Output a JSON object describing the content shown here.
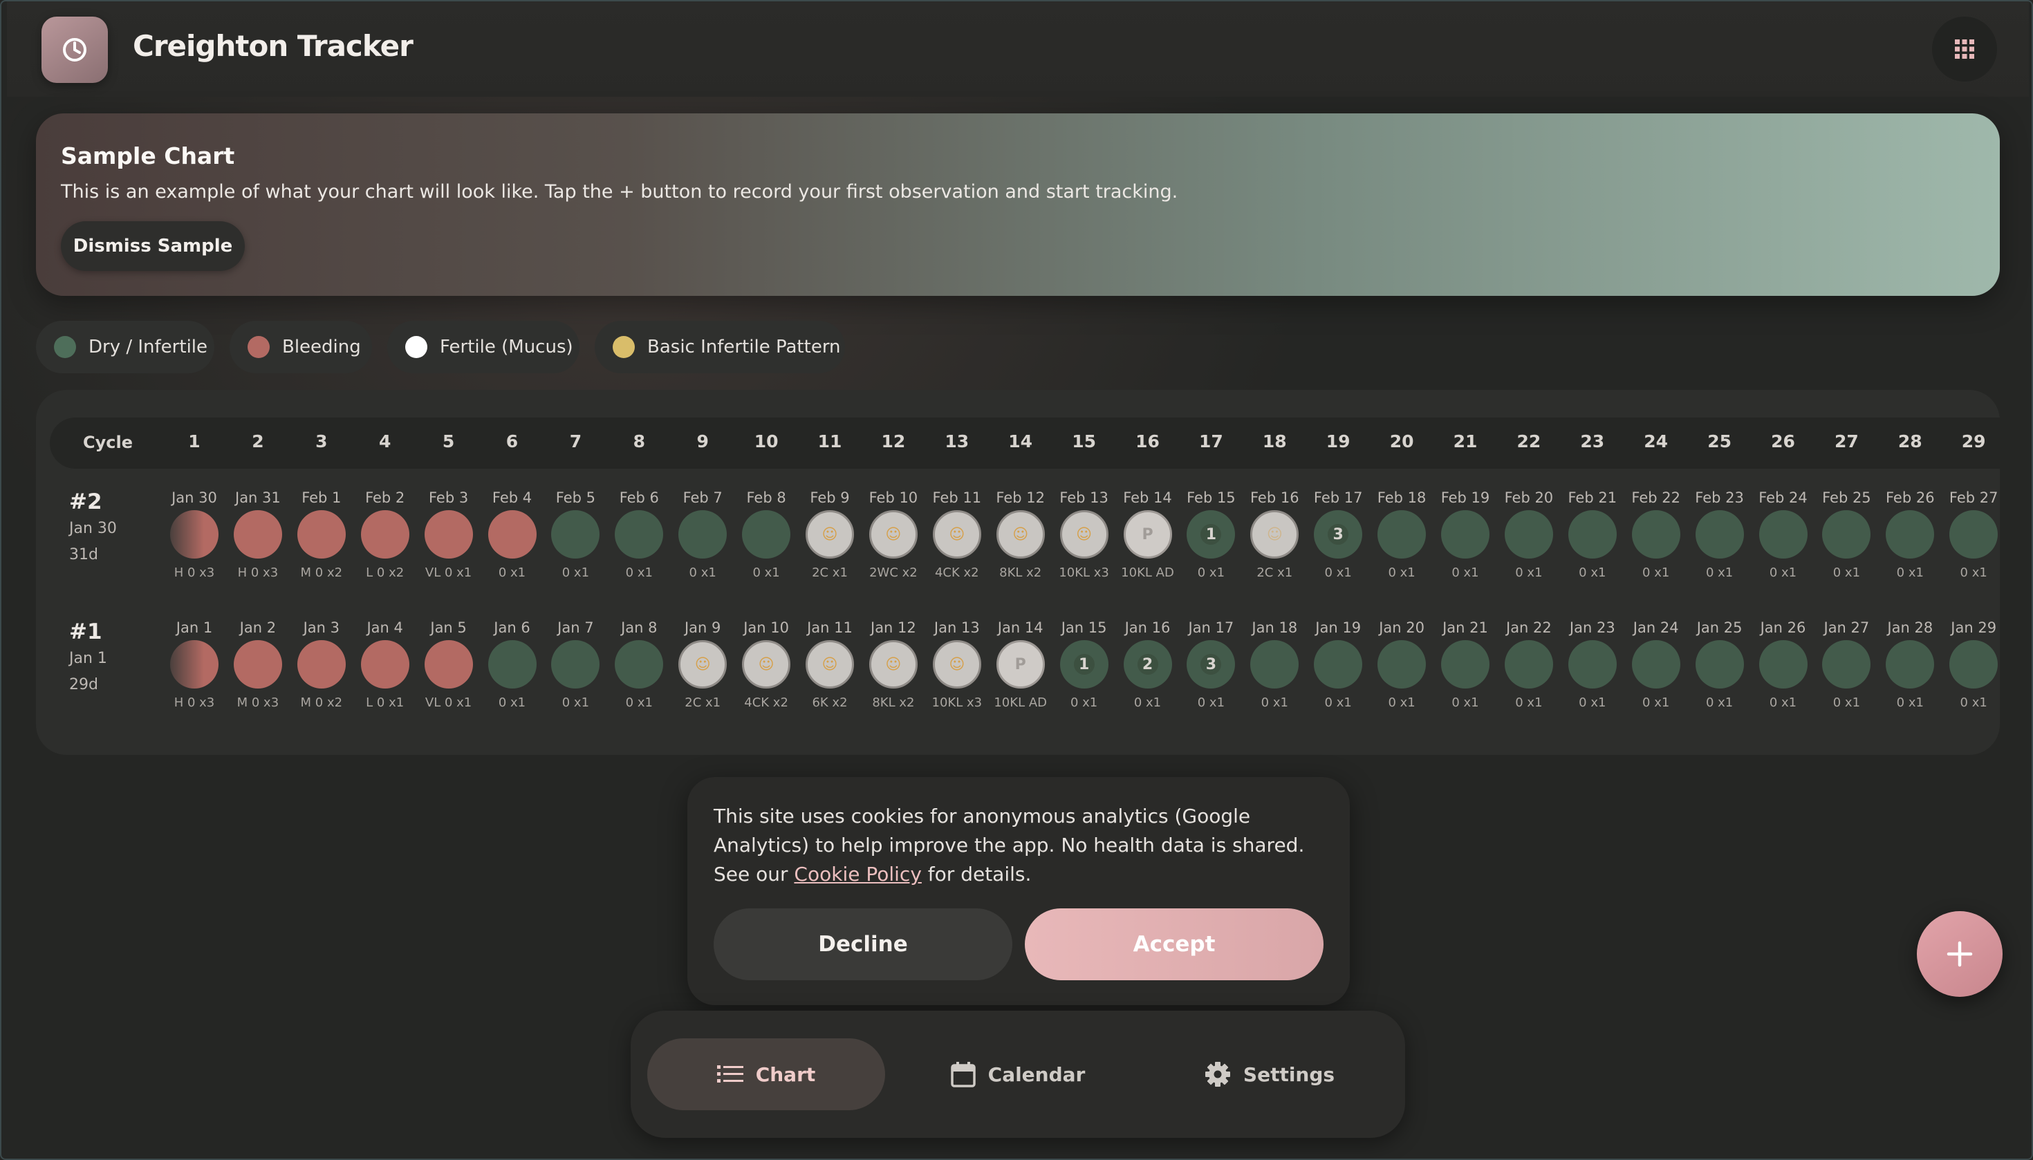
{
  "app": {
    "title": "Creighton Tracker"
  },
  "banner": {
    "title": "Sample Chart",
    "text": "This is an example of what your chart will look like. Tap the + button to record your first observation and start tracking.",
    "dismiss_label": "Dismiss Sample"
  },
  "legend": [
    {
      "label": "Dry / Infertile",
      "color": "#4e6e5a"
    },
    {
      "label": "Bleeding",
      "color": "#b36a63"
    },
    {
      "label": "Fertile (Mucus)",
      "color": "#ffffff"
    },
    {
      "label": "Basic Infertile Pattern",
      "color": "#d9bd6a"
    }
  ],
  "chart": {
    "cycle_header": "Cycle",
    "columns": [
      "1",
      "2",
      "3",
      "4",
      "5",
      "6",
      "7",
      "8",
      "9",
      "10",
      "11",
      "12",
      "13",
      "14",
      "15",
      "16",
      "17",
      "18",
      "19",
      "20",
      "21",
      "22",
      "23",
      "24",
      "25",
      "26",
      "27",
      "28",
      "29"
    ],
    "cycles": [
      {
        "number": "#2",
        "start": "Jan 30",
        "length": "31d",
        "days": [
          {
            "date": "Jan 30",
            "obs": "H 0 x3",
            "type": "bleed-fade"
          },
          {
            "date": "Jan 31",
            "obs": "H 0 x3",
            "type": "bleed"
          },
          {
            "date": "Feb 1",
            "obs": "M 0 x2",
            "type": "bleed"
          },
          {
            "date": "Feb 2",
            "obs": "L 0 x2",
            "type": "bleed"
          },
          {
            "date": "Feb 3",
            "obs": "VL 0 x1",
            "type": "bleed"
          },
          {
            "date": "Feb 4",
            "obs": "0 x1",
            "type": "bleed"
          },
          {
            "date": "Feb 5",
            "obs": "0 x1",
            "type": "dry"
          },
          {
            "date": "Feb 6",
            "obs": "0 x1",
            "type": "dry"
          },
          {
            "date": "Feb 7",
            "obs": "0 x1",
            "type": "dry"
          },
          {
            "date": "Feb 8",
            "obs": "0 x1",
            "type": "dry"
          },
          {
            "date": "Feb 9",
            "obs": "2C x1",
            "type": "fertile"
          },
          {
            "date": "Feb 10",
            "obs": "2WC x2",
            "type": "fertile"
          },
          {
            "date": "Feb 11",
            "obs": "4CK x2",
            "type": "fertile"
          },
          {
            "date": "Feb 12",
            "obs": "8KL x2",
            "type": "fertile"
          },
          {
            "date": "Feb 13",
            "obs": "10KL x3",
            "type": "fertile"
          },
          {
            "date": "Feb 14",
            "obs": "10KL AD",
            "type": "peak",
            "mark": "P"
          },
          {
            "date": "Feb 15",
            "obs": "0 x1",
            "type": "count",
            "mark": "1"
          },
          {
            "date": "Feb 16",
            "obs": "2C x1",
            "type": "fertile-faint"
          },
          {
            "date": "Feb 17",
            "obs": "0 x1",
            "type": "count",
            "mark": "3"
          },
          {
            "date": "Feb 18",
            "obs": "0 x1",
            "type": "dry"
          },
          {
            "date": "Feb 19",
            "obs": "0 x1",
            "type": "dry"
          },
          {
            "date": "Feb 20",
            "obs": "0 x1",
            "type": "dry"
          },
          {
            "date": "Feb 21",
            "obs": "0 x1",
            "type": "dry"
          },
          {
            "date": "Feb 22",
            "obs": "0 x1",
            "type": "dry"
          },
          {
            "date": "Feb 23",
            "obs": "0 x1",
            "type": "dry"
          },
          {
            "date": "Feb 24",
            "obs": "0 x1",
            "type": "dry"
          },
          {
            "date": "Feb 25",
            "obs": "0 x1",
            "type": "dry"
          },
          {
            "date": "Feb 26",
            "obs": "0 x1",
            "type": "dry"
          },
          {
            "date": "Feb 27",
            "obs": "0 x1",
            "type": "dry"
          }
        ]
      },
      {
        "number": "#1",
        "start": "Jan 1",
        "length": "29d",
        "days": [
          {
            "date": "Jan 1",
            "obs": "H 0 x3",
            "type": "bleed-fade"
          },
          {
            "date": "Jan 2",
            "obs": "M 0 x3",
            "type": "bleed"
          },
          {
            "date": "Jan 3",
            "obs": "M 0 x2",
            "type": "bleed"
          },
          {
            "date": "Jan 4",
            "obs": "L 0 x1",
            "type": "bleed"
          },
          {
            "date": "Jan 5",
            "obs": "VL 0 x1",
            "type": "bleed"
          },
          {
            "date": "Jan 6",
            "obs": "0 x1",
            "type": "dry"
          },
          {
            "date": "Jan 7",
            "obs": "0 x1",
            "type": "dry"
          },
          {
            "date": "Jan 8",
            "obs": "0 x1",
            "type": "dry"
          },
          {
            "date": "Jan 9",
            "obs": "2C x1",
            "type": "fertile"
          },
          {
            "date": "Jan 10",
            "obs": "4CK x2",
            "type": "fertile"
          },
          {
            "date": "Jan 11",
            "obs": "6K x2",
            "type": "fertile"
          },
          {
            "date": "Jan 12",
            "obs": "8KL x2",
            "type": "fertile"
          },
          {
            "date": "Jan 13",
            "obs": "10KL x3",
            "type": "fertile"
          },
          {
            "date": "Jan 14",
            "obs": "10KL AD",
            "type": "peak",
            "mark": "P"
          },
          {
            "date": "Jan 15",
            "obs": "0 x1",
            "type": "count",
            "mark": "1"
          },
          {
            "date": "Jan 16",
            "obs": "0 x1",
            "type": "count",
            "mark": "2"
          },
          {
            "date": "Jan 17",
            "obs": "0 x1",
            "type": "count",
            "mark": "3"
          },
          {
            "date": "Jan 18",
            "obs": "0 x1",
            "type": "dry"
          },
          {
            "date": "Jan 19",
            "obs": "0 x1",
            "type": "dry"
          },
          {
            "date": "Jan 20",
            "obs": "0 x1",
            "type": "dry"
          },
          {
            "date": "Jan 21",
            "obs": "0 x1",
            "type": "dry"
          },
          {
            "date": "Jan 22",
            "obs": "0 x1",
            "type": "dry"
          },
          {
            "date": "Jan 23",
            "obs": "0 x1",
            "type": "dry"
          },
          {
            "date": "Jan 24",
            "obs": "0 x1",
            "type": "dry"
          },
          {
            "date": "Jan 25",
            "obs": "0 x1",
            "type": "dry"
          },
          {
            "date": "Jan 26",
            "obs": "0 x1",
            "type": "dry"
          },
          {
            "date": "Jan 27",
            "obs": "0 x1",
            "type": "dry"
          },
          {
            "date": "Jan 28",
            "obs": "0 x1",
            "type": "dry"
          },
          {
            "date": "Jan 29",
            "obs": "0 x1",
            "type": "dry"
          }
        ]
      }
    ]
  },
  "cookie": {
    "text_before": "This site uses cookies for anonymous analytics (Google Analytics) to help improve the app. No health data is shared. See our ",
    "link_text": "Cookie Policy",
    "text_after": " for details.",
    "decline_label": "Decline",
    "accept_label": "Accept"
  },
  "nav": {
    "chart_label": "Chart",
    "calendar_label": "Calendar",
    "settings_label": "Settings"
  },
  "icons": {
    "logo": "moon-icon",
    "apps": "grid-icon",
    "fab": "plus-icon",
    "chart": "list-icon",
    "calendar": "calendar-icon",
    "settings": "gear-icon",
    "fertile_marker": "baby-icon"
  }
}
